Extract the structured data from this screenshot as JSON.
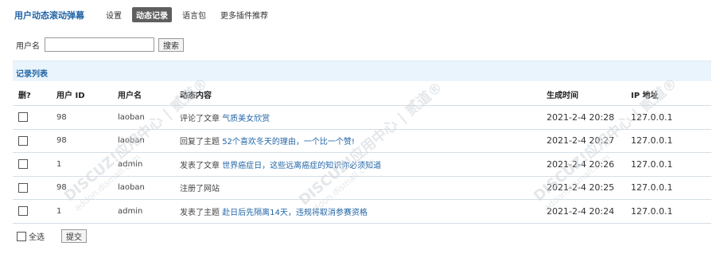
{
  "header": {
    "title": "用户动态滚动弹幕",
    "nav": [
      "设置",
      "动态记录",
      "语言包",
      "更多插件推荐"
    ],
    "active_index": 1
  },
  "search": {
    "label": "用户名",
    "value": "",
    "button": "搜索"
  },
  "section": {
    "title": "记录列表"
  },
  "table": {
    "columns": [
      "删?",
      "用户 ID",
      "用户名",
      "动态内容",
      "生成时间",
      "IP 地址"
    ],
    "rows": [
      {
        "uid": "98",
        "username": "laoban",
        "action": "评论了文章",
        "link": "气质美女欣赏",
        "time": "2021-2-4 20:28",
        "ip": "127.0.0.1"
      },
      {
        "uid": "98",
        "username": "laoban",
        "action": "回复了主题",
        "link": "52个喜欢冬天的理由，一个比一个赞!",
        "time": "2021-2-4 20:27",
        "ip": "127.0.0.1"
      },
      {
        "uid": "1",
        "username": "admin",
        "action": "发表了文章",
        "link": "世界癌症日，这些远离癌症的知识你必须知道",
        "time": "2021-2-4 20:26",
        "ip": "127.0.0.1"
      },
      {
        "uid": "98",
        "username": "laoban",
        "action": "注册了网站",
        "link": "",
        "time": "2021-2-4 20:25",
        "ip": "127.0.0.1"
      },
      {
        "uid": "1",
        "username": "admin",
        "action": "发表了主题",
        "link": "赴日后先隔离14天，违规将取消参赛资格",
        "time": "2021-2-4 20:24",
        "ip": "127.0.0.1"
      }
    ]
  },
  "footer": {
    "select_all": "全选",
    "submit": "提交"
  },
  "watermark": {
    "text": "DISCUZ!应用中心 | 贰道®",
    "sub": "addon.dismall.com"
  },
  "colors": {
    "accent": "#2366a8",
    "header_bg": "#eaf4fc",
    "active_nav": "#5f5f5f"
  }
}
